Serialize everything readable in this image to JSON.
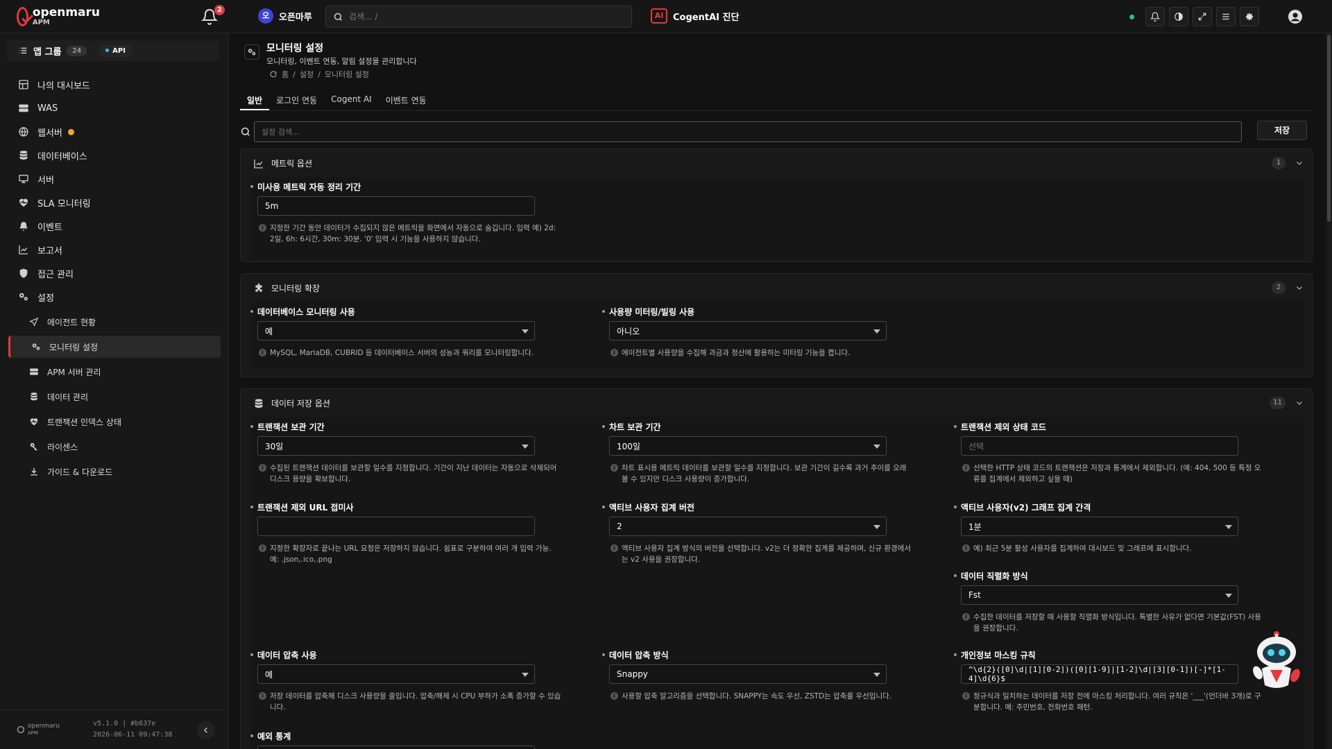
{
  "topbar": {
    "logo_name": "openmaru",
    "logo_sub": "APM",
    "notifications_count": "2",
    "org_initial": "오",
    "org_name": "오픈마루",
    "search_placeholder": "검색... /",
    "cogent_badge": "AI",
    "cogent_label": "CogentAI 진단",
    "status_color": "#2ec27e"
  },
  "sidebar": {
    "app_group_label": "앱 그룹",
    "app_group_count": "24",
    "api_badge": "API",
    "items": [
      {
        "label": "나의 대시보드",
        "icon": "dashboard-icon"
      },
      {
        "label": "WAS",
        "icon": "server-rack-icon"
      },
      {
        "label": "웹서버",
        "icon": "globe-icon"
      },
      {
        "label": "데이터베이스",
        "icon": "database-icon"
      },
      {
        "label": "서버",
        "icon": "monitor-icon"
      },
      {
        "label": "SLA 모니터링",
        "icon": "heart-pulse-icon"
      },
      {
        "label": "이벤트",
        "icon": "bell-icon"
      },
      {
        "label": "보고서",
        "icon": "chart-icon"
      },
      {
        "label": "접근 관리",
        "icon": "shield-icon"
      },
      {
        "label": "설정",
        "icon": "gears-icon"
      }
    ],
    "subitems": [
      {
        "label": "에이전트 현황",
        "icon": "send-icon"
      },
      {
        "label": "모니터링 설정",
        "icon": "gears-icon"
      },
      {
        "label": "APM 서버 관리",
        "icon": "server-rack-icon"
      },
      {
        "label": "데이터 관리",
        "icon": "database-icon"
      },
      {
        "label": "트랜잭션 인덱스 상태",
        "icon": "heart-pulse-icon"
      },
      {
        "label": "라이센스",
        "icon": "key-icon"
      },
      {
        "label": "가이드 & 다운로드",
        "icon": "download-icon"
      }
    ],
    "footer_logo": "openmaru",
    "footer_logo_sub": "APM",
    "version": "v5.1.0 | #b637e",
    "build_date": "2026-06-11 09:47:38"
  },
  "page": {
    "title": "모니터링 설정",
    "subtitle": "모니터링, 이벤트 연동, 알림 설정을 관리합니다",
    "breadcrumb": [
      "홈",
      "설정",
      "모니터링 설정"
    ],
    "tabs": [
      "일반",
      "로그인 연동",
      "Cogent AI",
      "이벤트 연동"
    ],
    "settings_search_placeholder": "설정 검색...",
    "save_label": "저장"
  },
  "sections": {
    "metric": {
      "title": "메트릭 옵션",
      "count": "1",
      "fields": [
        {
          "label": "미사용 메트릭 자동 정리 기간",
          "value": "5m",
          "help": "지정한 기간 동안 데이터가 수집되지 않은 메트릭을 화면에서 자동으로 숨깁니다. 입력 예) 2d: 2일, 6h: 6시간, 30m: 30분. '0' 입력 시 기능을 사용하지 않습니다."
        }
      ]
    },
    "extension": {
      "title": "모니터링 확장",
      "count": "2",
      "fields": [
        {
          "label": "데이터베이스 모니터링 사용",
          "value": "예",
          "help": "MySQL, MariaDB, CUBRID 등 데이터베이스 서버의 성능과 쿼리를 모니터링합니다."
        },
        {
          "label": "사용량 미터링/빌링 사용",
          "value": "아니오",
          "help": "에이전트별 사용량을 수집해 과금과 정산에 활용하는 미터링 기능을 켭니다."
        }
      ]
    },
    "storage": {
      "title": "데이터 저장 옵션",
      "count": "11",
      "fields": [
        {
          "label": "트랜잭션 보관 기간",
          "value": "30일",
          "help": "수집된 트랜잭션 데이터를 보관할 일수를 지정합니다. 기간이 지난 데이터는 자동으로 삭제되어 디스크 용량을 확보합니다."
        },
        {
          "label": "차트 보관 기간",
          "value": "100일",
          "help": "차트 표시용 메트릭 데이터를 보관할 일수를 지정합니다. 보관 기간이 길수록 과거 추이를 오래 볼 수 있지만 디스크 사용량이 증가합니다."
        },
        {
          "label": "트랜잭션 제외 상태 코드",
          "value": "",
          "placeholder": "선택",
          "help": "선택한 HTTP 상태 코드의 트랜잭션은 저장과 통계에서 제외합니다. (예: 404, 500 등 특정 오류를 집계에서 제외하고 싶을 때)"
        },
        {
          "label": "트랜잭션 제외 URL 접미사",
          "value": "",
          "help": "지정한 확장자로 끝나는 URL 요청은 저장하지 않습니다. 쉼표로 구분하여 여러 개 입력 가능. 예: .json,.ico,.png"
        },
        {
          "label": "액티브 사용자 집계 버전",
          "value": "2",
          "help": "액티브 사용자 집계 방식의 버전을 선택합니다. v2는 더 정확한 집계를 제공하며, 신규 환경에서는 v2 사용을 권장합니다."
        },
        {
          "label": "액티브 사용자(v2) 그래프 집계 간격",
          "value": "1분",
          "help": "예) 최근 5분 활성 사용자를 집계하여 대시보드 및 그래프에 표시합니다."
        },
        {
          "label": "데이터 직렬화 방식",
          "value": "Fst",
          "help": "수집한 데이터를 저장할 때 사용할 직렬화 방식입니다. 특별한 사유가 없다면 기본값(FST) 사용을 권장합니다."
        },
        {
          "label": "데이터 압축 사용",
          "value": "예",
          "help": "저장 데이터를 압축해 디스크 사용량을 줄입니다. 압축/해제 시 CPU 부하가 소폭 증가할 수 있습니다."
        },
        {
          "label": "데이터 압축 방식",
          "value": "Snappy",
          "help": "사용할 압축 알고리즘을 선택합니다. SNAPPY는 속도 우선, ZSTD는 압축률 우선입니다."
        },
        {
          "label": "개인정보 마스킹 규칙",
          "value": "^\\d{2}([0]\\d|[1][0-2])([0][1-9]|[1-2]\\d|[3][0-1])[-]*[1-4]\\d{6}$",
          "help": "정규식과 일치하는 데이터를 저장 전에 마스킹 처리합니다. 여러 규칙은 '___'(언더바 3개)로 구분합니다. 예: 주민번호, 전화번호 패턴."
        },
        {
          "label": "예외 통계",
          "value": ""
        }
      ]
    }
  },
  "colors": {
    "accent": "#e5393d",
    "warning_dot": "#f5a623",
    "background": "#121212"
  }
}
